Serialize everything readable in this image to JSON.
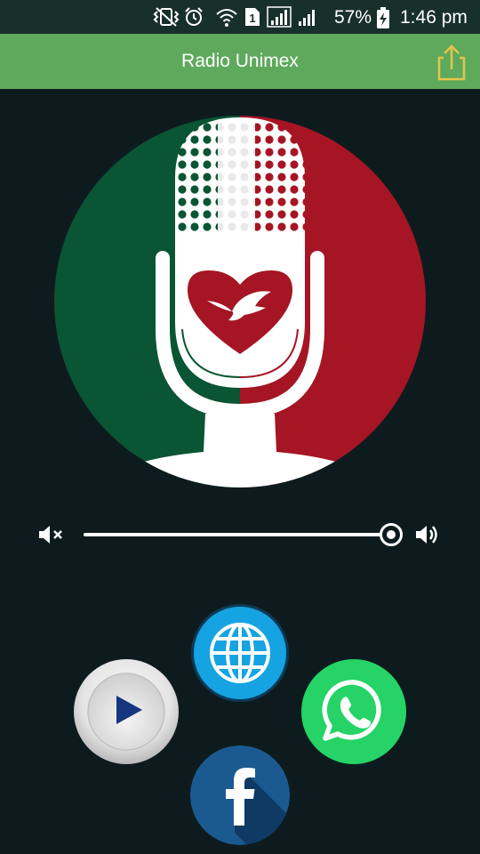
{
  "status_bar": {
    "battery_percent": "57%",
    "time": "1:46 pm",
    "sim_slot": "1",
    "icons": [
      "vibrate-icon",
      "alarm-icon",
      "wifi-icon",
      "sim-1-icon",
      "signal-icon",
      "signal-icon",
      "battery-charging-icon"
    ]
  },
  "app_bar": {
    "title": "Radio Unimex",
    "share_icon": "share-icon"
  },
  "logo": {
    "icon": "microphone-heart-logo",
    "colors": {
      "green": "#0a5533",
      "red": "#a51524",
      "white": "#ffffff"
    }
  },
  "player": {
    "volume_level": 1.0,
    "mute_icon": "volume-mute-icon",
    "volume_icon": "volume-up-icon"
  },
  "actions": [
    {
      "id": "website",
      "icon": "globe-icon",
      "color": "#16a3e2"
    },
    {
      "id": "play",
      "icon": "play-icon",
      "color": "#16367f"
    },
    {
      "id": "whatsapp",
      "icon": "whatsapp-icon",
      "color": "#25d366"
    },
    {
      "id": "facebook",
      "icon": "facebook-icon",
      "color": "#1b5a91"
    }
  ],
  "colors": {
    "background": "#0e1b1e",
    "status_bar": "#18302a",
    "app_bar": "#5ea95c",
    "share_icon": "#e3c54a"
  }
}
